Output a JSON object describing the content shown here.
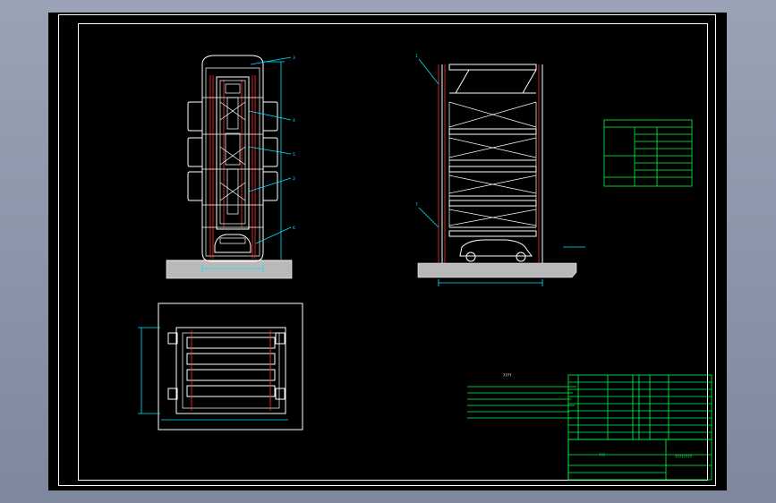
{
  "drawing": {
    "background_color": "#000000",
    "window_color": "#8c95a8",
    "line_colors": {
      "outline": "#ffffff",
      "highlight": "#ff3030",
      "dimension": "#00e5ff",
      "table": "#00ff40"
    }
  },
  "front_view": {
    "balloons": [
      "3",
      "4",
      "5",
      "2",
      "6"
    ]
  },
  "side_view": {
    "balloons": [
      "1",
      "7"
    ]
  },
  "param_table": {
    "title": "",
    "cells": [
      "",
      "",
      "",
      "",
      "",
      "",
      "",
      ""
    ]
  },
  "notes": {
    "title": "????"
  },
  "title_block": {
    "drawing_code": "????????",
    "scale_label": "???"
  }
}
